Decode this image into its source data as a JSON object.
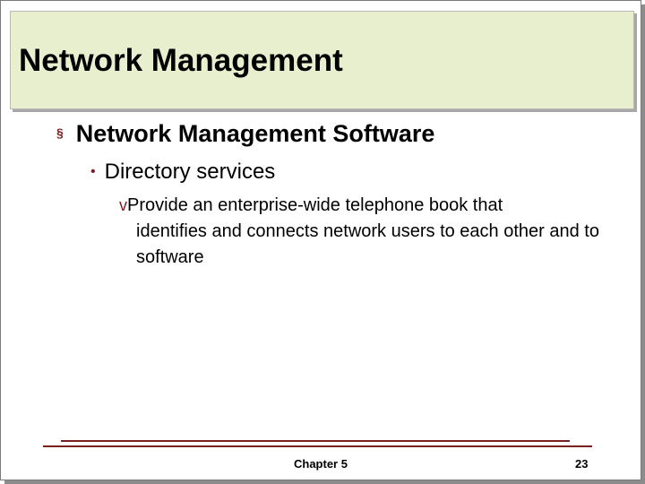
{
  "slide": {
    "title": "Network Management",
    "bullets": {
      "level1": {
        "marker": "§",
        "text": "Network Management Software"
      },
      "level2": {
        "marker": "•",
        "text": "Directory services"
      },
      "level3": {
        "marker": "v",
        "line1": "Provide an enterprise-wide telephone book that",
        "rest": "identifies and connects network users to each other and to software"
      }
    },
    "footer": {
      "center": "Chapter 5",
      "page_number": "23"
    },
    "colors": {
      "title_bar": "#e8efce",
      "accent": "#7a1f1f"
    }
  }
}
